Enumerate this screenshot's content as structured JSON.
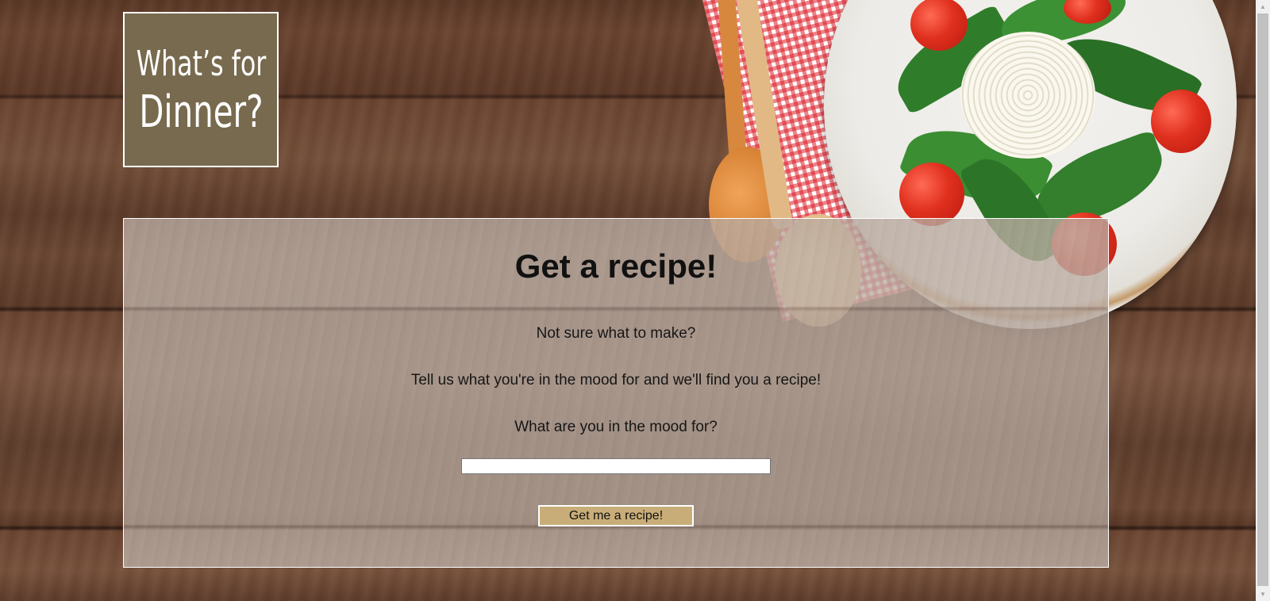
{
  "logo": {
    "line1": "What’s for",
    "line2": "Dinner?"
  },
  "main": {
    "title": "Get a recipe!",
    "intro": "Not sure what to make?",
    "description": "Tell us what you're in the mood for and we'll find you a recipe!",
    "prompt": "What are you in the mood for?",
    "input_value": "",
    "button_label": "Get me a recipe!"
  },
  "colors": {
    "logo_background": "#786a4e",
    "button_background": "#c9ad78",
    "panel_border": "#ffffff",
    "wood_background": "#5e3c2b"
  },
  "icons": {
    "scroll_up": "scroll-up-arrow-icon",
    "scroll_down": "scroll-down-arrow-icon"
  }
}
